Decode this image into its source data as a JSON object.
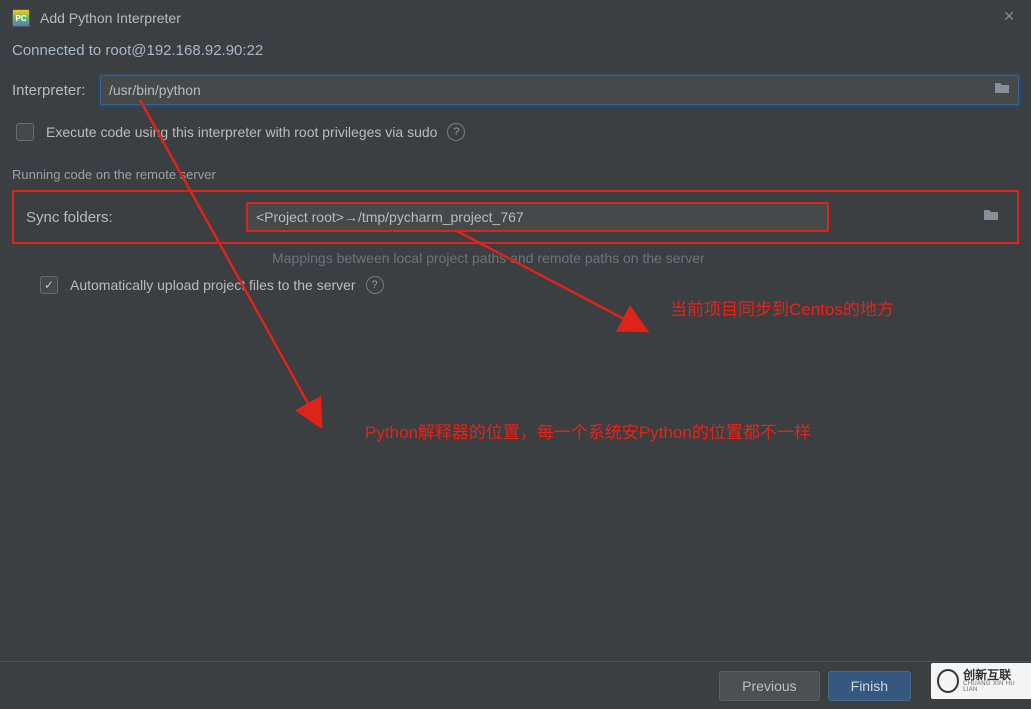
{
  "dialog": {
    "title": "Add Python Interpreter",
    "connected": "Connected to root@192.168.92.90:22",
    "interpreter_label": "Interpreter:",
    "interpreter_value": "/usr/bin/python",
    "sudo_checkbox": "Execute code using this interpreter with root privileges via sudo",
    "section_remote": "Running code on the remote server",
    "sync_label": "Sync folders:",
    "sync_value": "<Project root>→/tmp/pycharm_project_767",
    "mapping_hint": "Mappings between local project paths and remote paths on the server",
    "auto_upload": "Automatically upload project files to the server"
  },
  "annotations": {
    "centos": "当前项目同步到Centos的地方",
    "python_loc": "Python解释器的位置，每一个系统安Python的位置都不一样"
  },
  "footer": {
    "previous": "Previous",
    "finish": "Finish"
  },
  "watermark": {
    "cn": "创新互联",
    "en": "CHUANG XIN HU LIAN"
  },
  "colors": {
    "annotation_red": "#e6231a",
    "focus_blue": "#3d6185",
    "primary_btn": "#365880"
  }
}
